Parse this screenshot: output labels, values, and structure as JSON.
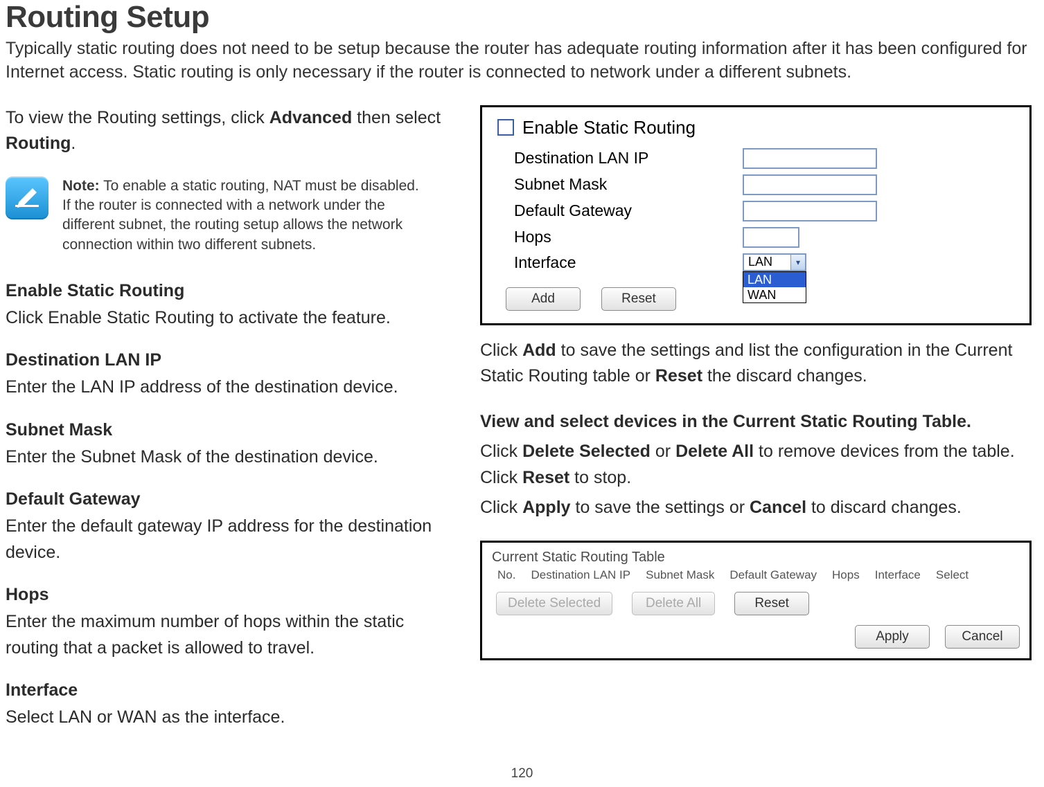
{
  "page": {
    "title": "Routing Setup",
    "intro": "Typically static routing does not need to be setup because the router has adequate routing information after it has been configured for Internet access. Static routing is only necessary if the router is connected to network under a different subnets.",
    "view_line_pre": "To view the Routing settings, click ",
    "view_line_b1": "Advanced",
    "view_line_mid": " then select ",
    "view_line_b2": "Routing",
    "view_line_post": ".",
    "number": "120"
  },
  "note": {
    "label": "Note:",
    "body_l1": " To enable a static routing, NAT must be disabled.",
    "body_rest": "If the router is connected with a network under the different subnet, the routing setup allows the network connection within two different subnets."
  },
  "sections": {
    "enable_head": "Enable Static Routing",
    "enable_body": "Click Enable Static Routing to activate the feature.",
    "dest_head": "Destination LAN IP",
    "dest_body": "Enter the LAN IP address of the destination device.",
    "mask_head": "Subnet Mask",
    "mask_body": "Enter the Subnet Mask of the destination device.",
    "gw_head": "Default Gateway",
    "gw_body": "Enter the default gateway IP address for the destination device.",
    "hops_head": "Hops",
    "hops_body": "Enter the maximum number of hops within the static routing that a packet is allowed to travel.",
    "iface_head": "Interface",
    "iface_body": "Select LAN or WAN as the interface."
  },
  "form": {
    "enable_label": "Enable Static Routing",
    "dest_label": "Destination LAN IP",
    "mask_label": "Subnet Mask",
    "gw_label": "Default Gateway",
    "hops_label": "Hops",
    "iface_label": "Interface",
    "iface_selected": "LAN",
    "iface_opt1": "LAN",
    "iface_opt2": "WAN",
    "btn_add": "Add",
    "btn_reset": "Reset"
  },
  "right_text": {
    "p1_pre": "Click ",
    "p1_b1": "Add",
    "p1_mid": " to save the settings and list the configuration in the Current Static Routing table or ",
    "p1_b2": "Reset",
    "p1_post": " the discard changes.",
    "p2": "View and select devices in the Current Static Routing Table.",
    "p3_pre": "Click ",
    "p3_b1": "Delete Selected",
    "p3_mid": " or ",
    "p3_b2": "Delete All",
    "p3_post": " to remove devices from the table. Click ",
    "p3_b3": "Reset",
    "p3_end": " to stop.",
    "p4_pre": "Click ",
    "p4_b1": "Apply",
    "p4_mid": " to save the settings or ",
    "p4_b2": "Cancel",
    "p4_post": " to discard changes."
  },
  "table": {
    "title": "Current Static Routing Table",
    "col_no": "No.",
    "col_dest": "Destination LAN IP",
    "col_mask": "Subnet Mask",
    "col_gw": "Default Gateway",
    "col_hops": "Hops",
    "col_iface": "Interface",
    "col_sel": "Select",
    "btn_delsel": "Delete Selected",
    "btn_delall": "Delete All",
    "btn_reset": "Reset",
    "btn_apply": "Apply",
    "btn_cancel": "Cancel"
  }
}
